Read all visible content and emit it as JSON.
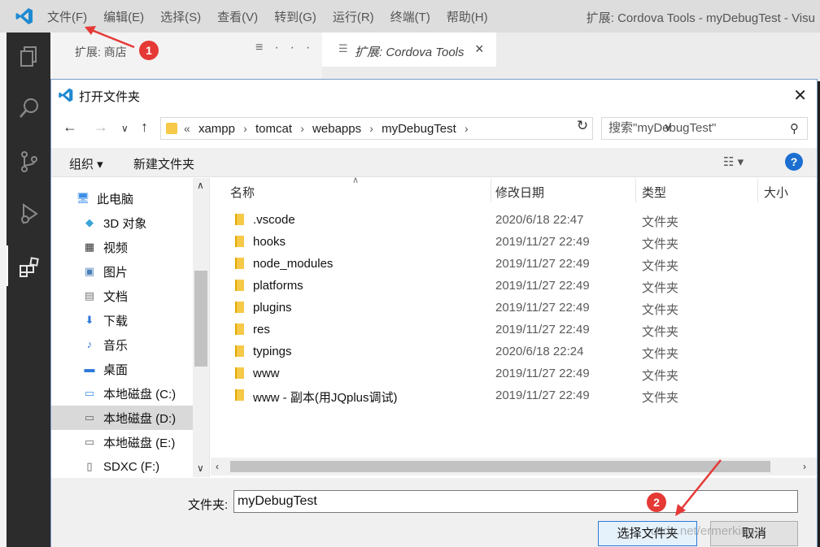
{
  "vscode": {
    "menu": [
      "文件(F)",
      "编辑(E)",
      "选择(S)",
      "查看(V)",
      "转到(G)",
      "运行(R)",
      "终端(T)",
      "帮助(H)"
    ],
    "window_title": "扩展: Cordova Tools - myDebugTest - Visu",
    "sidebar_title": "扩展: 商店",
    "editor_tab": "扩展: Cordova Tools"
  },
  "dialog": {
    "title": "打开文件夹",
    "breadcrumb": [
      "xampp",
      "tomcat",
      "webapps",
      "myDebugTest"
    ],
    "search_placeholder": "搜索\"myDebugTest\"",
    "organize": "组织 ▾",
    "new_folder": "新建文件夹",
    "help": "?",
    "nav": {
      "root": "此电脑",
      "items": [
        "3D 对象",
        "视频",
        "图片",
        "文档",
        "下载",
        "音乐",
        "桌面",
        "本地磁盘 (C:)",
        "本地磁盘 (D:)",
        "本地磁盘 (E:)",
        "SDXC (F:)"
      ],
      "selected": "本地磁盘 (D:)"
    },
    "columns": [
      "名称",
      "修改日期",
      "类型",
      "大小"
    ],
    "files": [
      {
        "name": ".vscode",
        "date": "2020/6/18 22:47",
        "type": "文件夹"
      },
      {
        "name": "hooks",
        "date": "2019/11/27 22:49",
        "type": "文件夹"
      },
      {
        "name": "node_modules",
        "date": "2019/11/27 22:49",
        "type": "文件夹"
      },
      {
        "name": "platforms",
        "date": "2019/11/27 22:49",
        "type": "文件夹"
      },
      {
        "name": "plugins",
        "date": "2019/11/27 22:49",
        "type": "文件夹"
      },
      {
        "name": "res",
        "date": "2019/11/27 22:49",
        "type": "文件夹"
      },
      {
        "name": "typings",
        "date": "2020/6/18 22:24",
        "type": "文件夹"
      },
      {
        "name": "www",
        "date": "2019/11/27 22:49",
        "type": "文件夹"
      },
      {
        "name": "www - 副本(用JQplus调试)",
        "date": "2019/11/27 22:49",
        "type": "文件夹"
      }
    ],
    "folder_label": "文件夹:",
    "folder_value": "myDebugTest",
    "select_button": "选择文件夹",
    "cancel_button": "取消"
  },
  "annotations": {
    "badge1": "1",
    "badge2": "2"
  },
  "watermark": "csdn.net/ermerking",
  "colors": {
    "accent": "#2b79d8",
    "badge": "#e53935",
    "folder": "#f7c948",
    "activity_bar": "#2c2c2c"
  }
}
